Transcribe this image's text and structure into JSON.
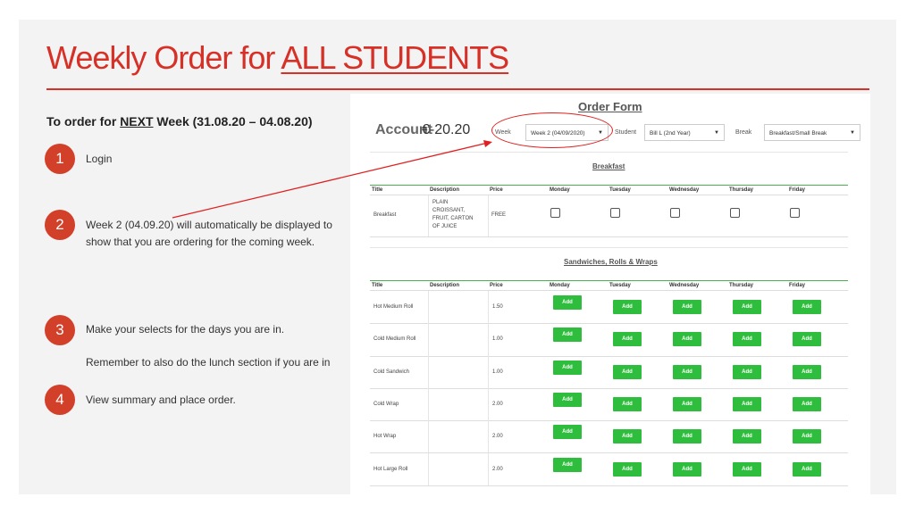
{
  "slide": {
    "title_prefix": "Weekly Order for ",
    "title_link": "ALL STUDENTS",
    "subheading": {
      "prefix": "To order for ",
      "emph": "NEXT",
      "suffix": " Week (31.08.20 – 04.08.20)"
    },
    "steps": [
      {
        "num": "1",
        "lines": [
          "Login"
        ]
      },
      {
        "num": "2",
        "lines": [
          "Week 2 (04.09.20) will automatically be displayed to",
          "show that you are ordering for the coming week."
        ]
      },
      {
        "num": "3",
        "lines": [
          "Make your selects for the days you are in.",
          "",
          "Remember to also do the lunch section if you are in"
        ]
      },
      {
        "num": "4",
        "lines": [
          "View summary and place order."
        ]
      }
    ]
  },
  "form": {
    "title": "Order Form",
    "account_label": "Account",
    "account_value": "€-20.20",
    "filters": {
      "week_label": "Week",
      "week_value": "Week 2 (04/09/2020)",
      "student_label": "Student",
      "student_value": "Bill L (2nd Year)",
      "break_label": "Break",
      "break_value": "Breakfast/Small Break"
    },
    "columns": [
      "Title",
      "Description",
      "Price",
      "Monday",
      "Tuesday",
      "Wednesday",
      "Thursday",
      "Friday"
    ],
    "breakfast": {
      "heading": "Breakfast",
      "rows": [
        {
          "title": "Breakfast",
          "description": [
            "PLAIN",
            "CROISSANT,",
            "FRUIT, CARTON",
            "OF JUICE"
          ],
          "price": "FREE"
        }
      ]
    },
    "sandwiches": {
      "heading": "Sandwiches, Rolls & Wraps",
      "add_label": "Add",
      "rows": [
        {
          "title": "Hot Medium Roll",
          "price": "1.50"
        },
        {
          "title": "Cold Medium Roll",
          "price": "1.00"
        },
        {
          "title": "Cold Sandwich",
          "price": "1.00"
        },
        {
          "title": "Cold Wrap",
          "price": "2.00"
        },
        {
          "title": "Hot Wrap",
          "price": "2.00"
        },
        {
          "title": "Hot Large Roll",
          "price": "2.00"
        }
      ]
    }
  },
  "colors": {
    "accent": "#d63027",
    "add_button": "#2fbd3d",
    "table_rule": "#4caf50"
  }
}
